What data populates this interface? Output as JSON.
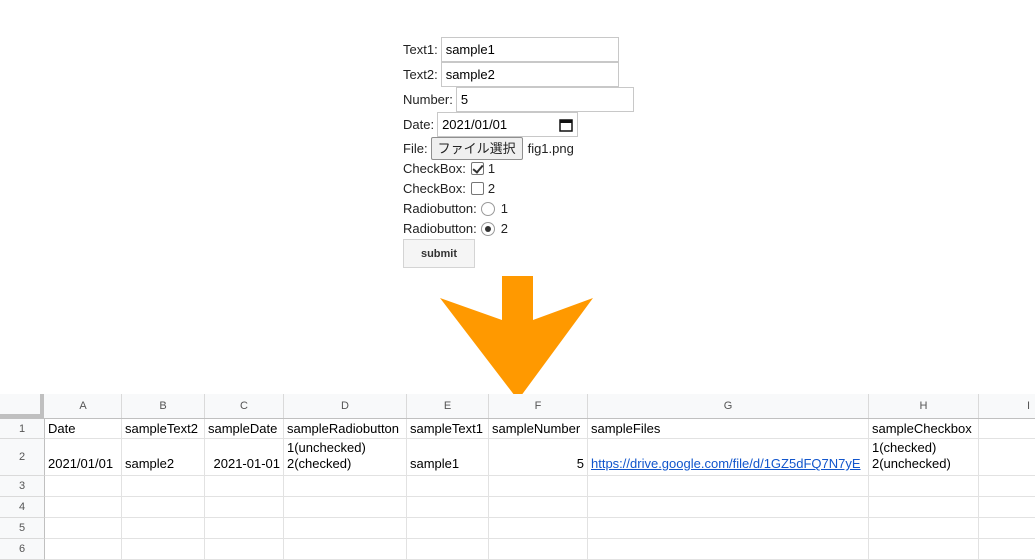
{
  "form": {
    "text1": {
      "label": "Text1:",
      "value": "sample1"
    },
    "text2": {
      "label": "Text2:",
      "value": "sample2"
    },
    "number": {
      "label": "Number:",
      "value": "5"
    },
    "date": {
      "label": "Date:",
      "value": "2021/01/01"
    },
    "file": {
      "label": "File:",
      "button": "ファイル選択",
      "filename": "fig1.png"
    },
    "checkbox1": {
      "label": "CheckBox:",
      "value": "1",
      "checked": true
    },
    "checkbox2": {
      "label": "CheckBox:",
      "value": "2",
      "checked": false
    },
    "radio1": {
      "label": "Radiobutton:",
      "value": "1",
      "checked": false
    },
    "radio2": {
      "label": "Radiobutton:",
      "value": "2",
      "checked": true
    },
    "submit": "submit"
  },
  "arrow": {
    "color": "#ff9900",
    "icon": "down-arrow-icon"
  },
  "sheet": {
    "columns": [
      "A",
      "B",
      "C",
      "D",
      "E",
      "F",
      "G",
      "H",
      "I"
    ],
    "rows": [
      "1",
      "2",
      "3",
      "4",
      "5",
      "6"
    ],
    "header_row": [
      "Date",
      "sampleText2",
      "sampleDate",
      "sampleRadiobutton",
      "sampleText1",
      "sampleNumber",
      "sampleFiles",
      "sampleCheckbox"
    ],
    "data_row": {
      "A": "2021/01/01",
      "B": "sample2",
      "C": "2021-01-01",
      "D": "1(unchecked)\n2(checked)",
      "E": "sample1",
      "F": "5",
      "G": "https://drive.google.com/file/d/1GZ5dFQ7N7yE",
      "H": "1(checked)\n2(unchecked)"
    },
    "link_color": "#1155cc"
  }
}
